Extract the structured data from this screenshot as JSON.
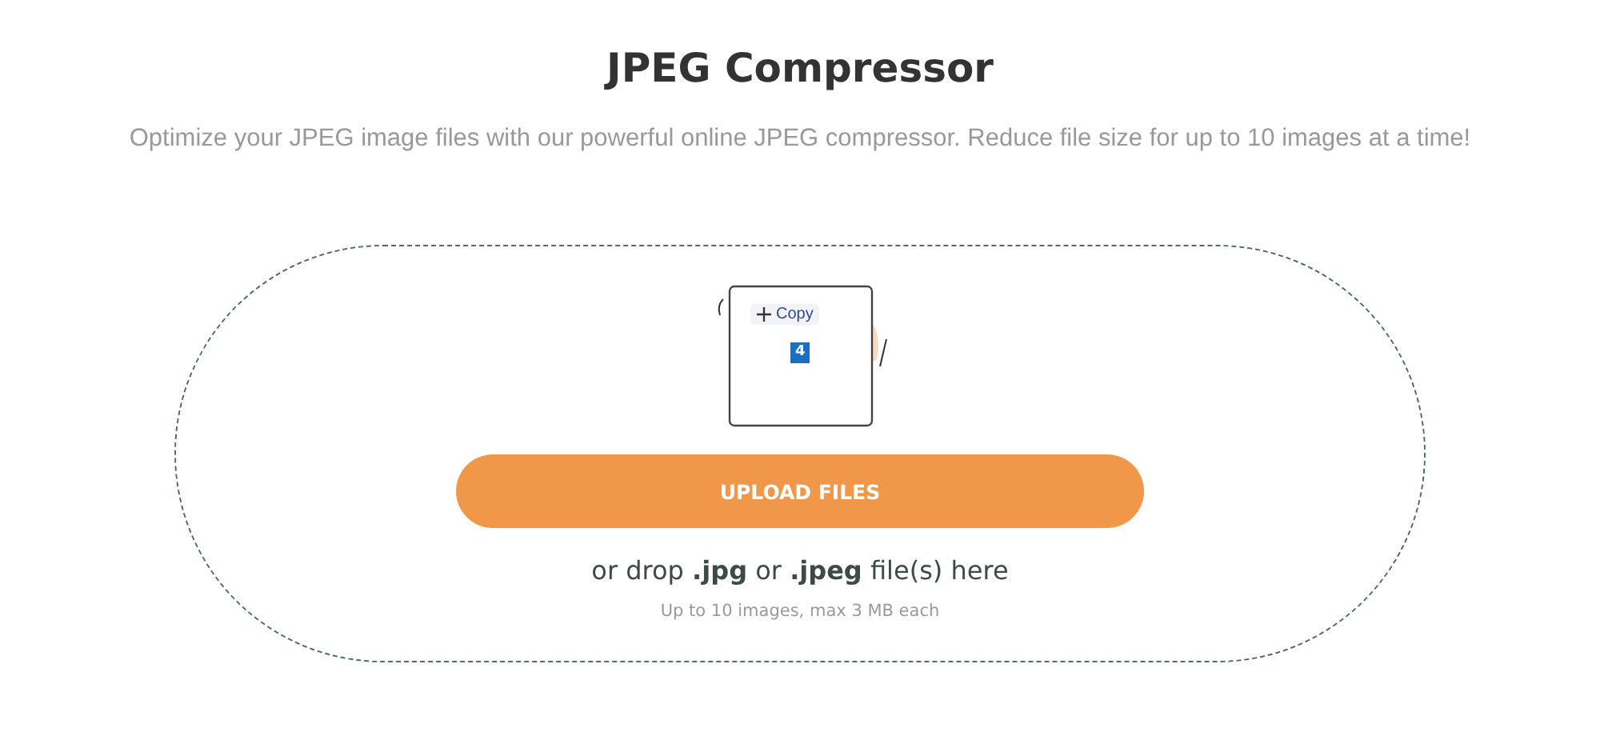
{
  "title": "JPEG Compressor",
  "subtitle": "Optimize your JPEG image files with our powerful online JPEG compressor. Reduce file size for up to 10 images at a time!",
  "dropzone": {
    "copy_label": "Copy",
    "count": "4",
    "button": "UPLOAD FILES",
    "drop_text": "or drop **.jpg** or **.jpeg** file(s) here",
    "limits": "Up to 10 images, max 3 MB each"
  }
}
